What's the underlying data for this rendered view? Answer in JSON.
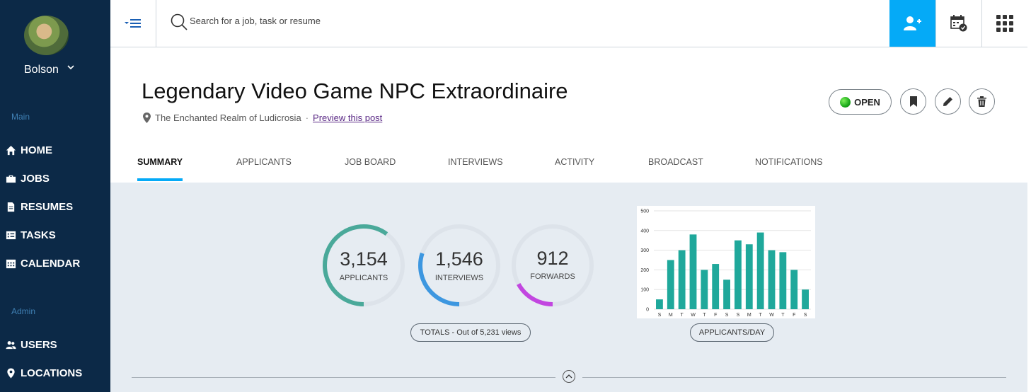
{
  "user": {
    "name": "Bolson"
  },
  "sidebar": {
    "main_label": "Main",
    "admin_label": "Admin",
    "items": [
      {
        "label": "HOME",
        "icon": "home-icon"
      },
      {
        "label": "JOBS",
        "icon": "briefcase-icon"
      },
      {
        "label": "RESUMES",
        "icon": "document-icon"
      },
      {
        "label": "TASKS",
        "icon": "checklist-icon"
      },
      {
        "label": "CALENDAR",
        "icon": "calendar-icon"
      },
      {
        "label": "USERS",
        "icon": "users-icon"
      },
      {
        "label": "LOCATIONS",
        "icon": "map-pin-icon"
      }
    ]
  },
  "search": {
    "placeholder": "Search for a job, task or resume"
  },
  "job": {
    "title": "Legendary Video Game NPC Extraordinaire",
    "location": "The Enchanted Realm of Ludicrosia",
    "separator": "·",
    "preview_link": "Preview this post",
    "status": "OPEN"
  },
  "tabs": [
    "SUMMARY",
    "APPLICANTS",
    "JOB BOARD",
    "INTERVIEWS",
    "ACTIVITY",
    "BROADCAST",
    "NOTIFICATIONS"
  ],
  "stats": [
    {
      "value": "3,154",
      "label": "APPLICANTS",
      "fraction": 0.6,
      "color": "#4aa99a"
    },
    {
      "value": "1,546",
      "label": "INTERVIEWS",
      "fraction": 0.3,
      "color": "#3d97e0"
    },
    {
      "value": "912",
      "label": "FORWARDS",
      "fraction": 0.17,
      "color": "#c246e0"
    }
  ],
  "totals_label": "TOTALS - Out of 5,231 views",
  "chart_label": "APPLICANTS/DAY",
  "chart_data": {
    "type": "bar",
    "categories": [
      "S",
      "M",
      "T",
      "W",
      "T",
      "F",
      "S",
      "S",
      "M",
      "T",
      "W",
      "T",
      "F",
      "S"
    ],
    "values": [
      50,
      250,
      300,
      380,
      200,
      230,
      150,
      350,
      330,
      390,
      300,
      290,
      200,
      100
    ],
    "ylim": [
      0,
      500
    ],
    "yticks": [
      0,
      100,
      200,
      300,
      400,
      500
    ],
    "bar_color": "#1fa89b",
    "grid": true
  }
}
